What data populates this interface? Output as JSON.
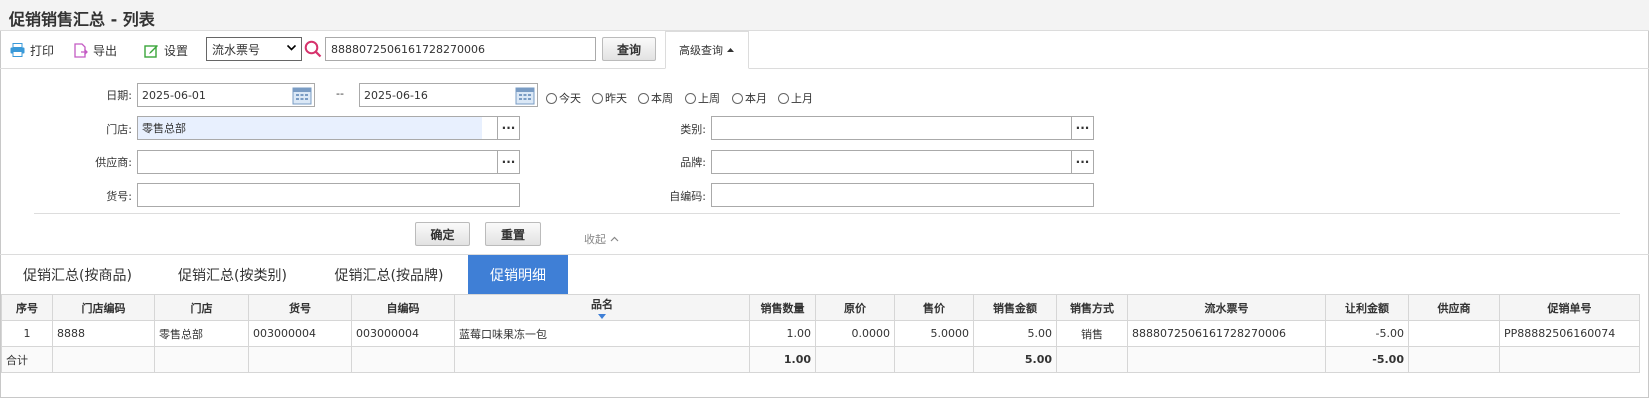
{
  "title": "促销销售汇总 - 列表",
  "toolbar": {
    "print": "打印",
    "export": "导出",
    "settings": "设置",
    "search_type": "流水票号",
    "search_value": "8888072506161728270006",
    "query": "查询",
    "advanced": "高级查询"
  },
  "filters": {
    "date_label": "日期:",
    "date_from": "2025-06-01",
    "date_sep": "--",
    "date_to": "2025-06-16",
    "quick": [
      "今天",
      "昨天",
      "本周",
      "上周",
      "本月",
      "上月"
    ],
    "store_label": "门店:",
    "store_value": "零售总部",
    "category_label": "类别:",
    "category_value": "",
    "supplier_label": "供应商:",
    "supplier_value": "",
    "brand_label": "品牌:",
    "brand_value": "",
    "item_no_label": "货号:",
    "item_no_value": "",
    "custom_code_label": "自编码:",
    "custom_code_value": "",
    "confirm": "确定",
    "reset": "重置",
    "collapse": "收起"
  },
  "tabs": [
    "促销汇总(按商品)",
    "促销汇总(按类别)",
    "促销汇总(按品牌)",
    "促销明细"
  ],
  "active_tab": 3,
  "table": {
    "headers": [
      "序号",
      "门店编码",
      "门店",
      "货号",
      "自编码",
      "品名",
      "销售数量",
      "原价",
      "售价",
      "销售金额",
      "销售方式",
      "流水票号",
      "让利金额",
      "供应商",
      "促销单号"
    ],
    "rows": [
      [
        "1",
        "8888",
        "零售总部",
        "003000004",
        "003000004",
        "蓝莓口味果冻一包",
        "1.00",
        "0.0000",
        "5.0000",
        "5.00",
        "销售",
        "8888072506161728270006",
        "-5.00",
        "",
        "PP88882506160074"
      ]
    ],
    "total": {
      "label": "合计",
      "qty": "1.00",
      "amount": "5.00",
      "discount": "-5.00"
    }
  },
  "colors": {
    "accent": "#3f7fd6",
    "highlight_input": "#e8f0fe"
  }
}
